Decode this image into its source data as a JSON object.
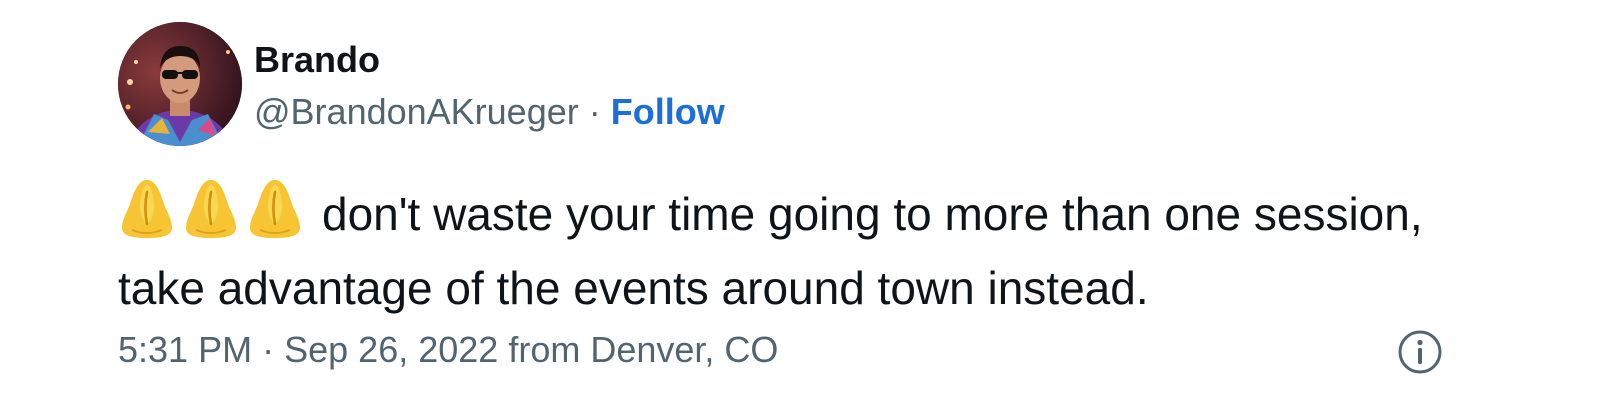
{
  "author": {
    "display_name": "Brando",
    "handle": "@BrandonAKrueger",
    "separator": "·",
    "follow_label": "Follow"
  },
  "tweet": {
    "emoji": "pinched-fingers-emoji",
    "emoji_count": 3,
    "text": "don't waste your time going to more than one session, take advantage of the events around town instead."
  },
  "meta": {
    "time": "5:31 PM",
    "separator": "·",
    "date": "Sep 26, 2022",
    "source": "from Denver, CO"
  },
  "icons": {
    "info": "info-icon"
  },
  "colors": {
    "text": "#0f1419",
    "secondary": "#536471",
    "link": "#1d6fd8"
  }
}
